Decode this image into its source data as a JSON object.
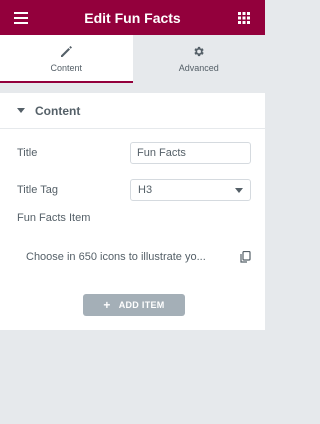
{
  "header": {
    "title": "Edit Fun Facts",
    "menu_icon": "hamburger-icon",
    "apps_icon": "grid-icon",
    "bg_color": "#93003c"
  },
  "tabs": [
    {
      "label": "Content",
      "icon": "pencil-icon",
      "active": true
    },
    {
      "label": "Advanced",
      "icon": "gear-icon",
      "active": false
    }
  ],
  "section": {
    "title": "Content",
    "fields": {
      "title_label": "Title",
      "title_value": "Fun Facts",
      "tag_label": "Title Tag",
      "tag_value": "H3",
      "items_label": "Fun Facts Item"
    },
    "items": [
      {
        "text": "Choose in 650 icons to illustrate yo..."
      }
    ],
    "add_button_label": "ADD ITEM"
  }
}
